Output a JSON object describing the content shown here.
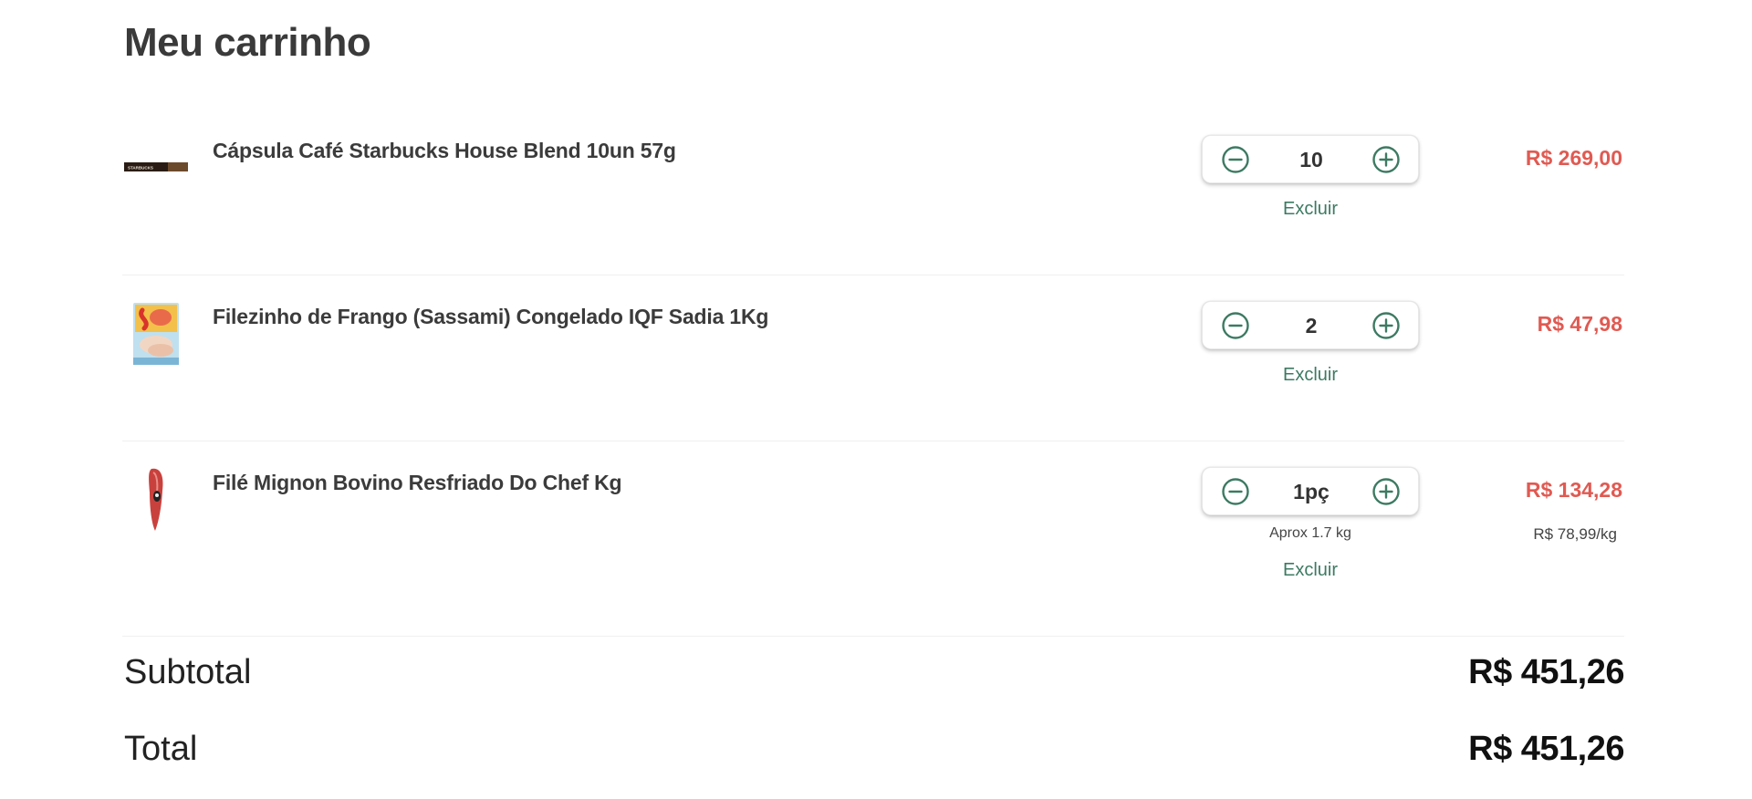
{
  "page": {
    "title": "Meu carrinho"
  },
  "cart": {
    "items": [
      {
        "name": "Cápsula Café Starbucks House Blend 10un 57g",
        "quantity": "10",
        "price": "R$ 269,00",
        "delete_label": "Excluir",
        "image_icon": "coffee-capsule-box-thumbnail",
        "image_text": "STARBUCKS"
      },
      {
        "name": "Filezinho de Frango (Sassami) Congelado IQF Sadia 1Kg",
        "quantity": "2",
        "price": "R$ 47,98",
        "delete_label": "Excluir",
        "image_icon": "frozen-chicken-bag-thumbnail"
      },
      {
        "name": "Filé Mignon Bovino Resfriado Do Chef Kg",
        "quantity": "1pç",
        "price": "R$ 134,28",
        "approx_weight": "Aprox 1.7 kg",
        "unit_price": "R$ 78,99/kg",
        "delete_label": "Excluir",
        "image_icon": "beef-tenderloin-thumbnail"
      }
    ]
  },
  "summary": {
    "subtotal_label": "Subtotal",
    "subtotal_value": "R$ 451,26",
    "total_label": "Total",
    "total_value": "R$ 451,26"
  },
  "colors": {
    "accent_green": "#3d7a63",
    "price_red": "#e05a52",
    "title_text": "#3a3a3a"
  },
  "icons": {
    "decrease": "minus-circle-icon",
    "increase": "plus-circle-icon"
  }
}
